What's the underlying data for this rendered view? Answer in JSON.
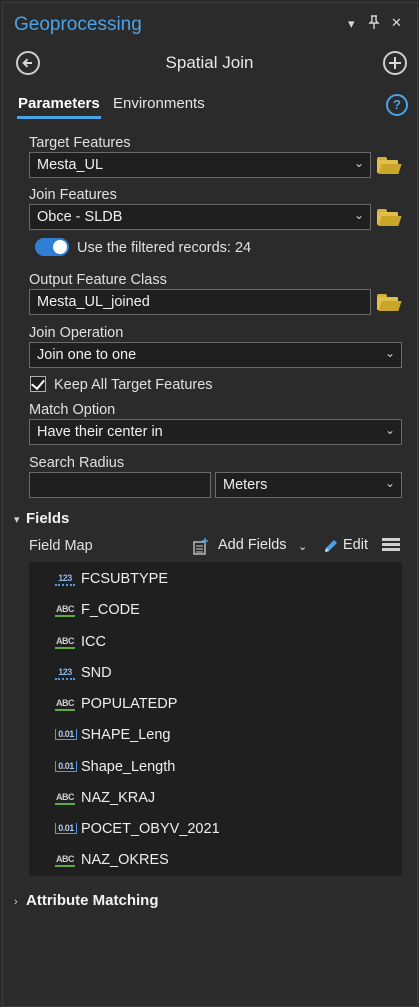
{
  "window": {
    "title": "Geoprocessing",
    "controls": [
      "▾",
      "✕"
    ]
  },
  "header": {
    "tool_title": "Spatial Join"
  },
  "tabs": [
    {
      "label": "Parameters",
      "active": true
    },
    {
      "label": "Environments",
      "active": false
    }
  ],
  "params": {
    "target_features": {
      "label": "Target Features",
      "value": "Mesta_UL"
    },
    "join_features": {
      "label": "Join Features",
      "value": "Obce - SLDB"
    },
    "filtered_toggle": {
      "label": "Use the filtered records: 24",
      "on": true
    },
    "output_feature_class": {
      "label": "Output Feature Class",
      "value": "Mesta_UL_joined"
    },
    "join_operation": {
      "label": "Join Operation",
      "value": "Join one to one"
    },
    "keep_all": {
      "label": "Keep All Target Features",
      "checked": true
    },
    "match_option": {
      "label": "Match Option",
      "value": "Have their center in"
    },
    "search_radius": {
      "label": "Search Radius",
      "value": "",
      "unit": "Meters"
    }
  },
  "fields_section": {
    "title": "Fields",
    "field_map_label": "Field Map",
    "add_fields_label": "Add Fields",
    "edit_label": "Edit",
    "fields": [
      {
        "name": "FCSUBTYPE",
        "type": "123"
      },
      {
        "name": "F_CODE",
        "type": "ABC"
      },
      {
        "name": "ICC",
        "type": "ABC"
      },
      {
        "name": "SND",
        "type": "123"
      },
      {
        "name": "POPULATEDP",
        "type": "ABC"
      },
      {
        "name": "SHAPE_Leng",
        "type": "0.01"
      },
      {
        "name": "Shape_Length",
        "type": "0.01"
      },
      {
        "name": "NAZ_KRAJ",
        "type": "ABC"
      },
      {
        "name": "POCET_OBYV_2021",
        "type": "0.01"
      },
      {
        "name": "NAZ_OKRES",
        "type": "ABC"
      }
    ]
  },
  "attribute_matching": {
    "title": "Attribute Matching"
  },
  "icons": {
    "back": "arrow-left-circle-icon",
    "add": "plus-circle-icon",
    "help": "question-circle-icon",
    "browse": "folder-icon"
  },
  "colors": {
    "accent": "#4ba3e8",
    "background": "#2b2b2b",
    "folder": "#e0c04a",
    "text_field_green": "#5faa46"
  }
}
